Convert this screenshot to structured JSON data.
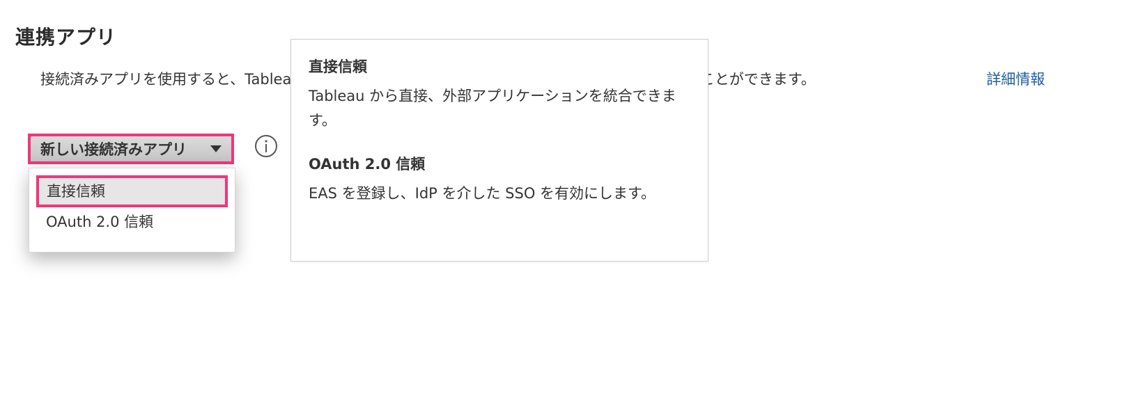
{
  "page": {
    "title": "連携アプリ",
    "intro_text": "接続済みアプリを使用すると、Tableau と外部アプリケーションの間の信頼関係を作成し、管理することができます。",
    "intro_link": "詳細情報"
  },
  "dropdown": {
    "label": "新しい接続済みアプリ",
    "items": [
      {
        "label": "直接信頼",
        "selected": true
      },
      {
        "label": "OAuth 2.0 信頼",
        "selected": false
      }
    ]
  },
  "tooltip": {
    "sections": [
      {
        "title": "直接信頼",
        "body": "Tableau から直接、外部アプリケーションを統合できます。"
      },
      {
        "title": "OAuth 2.0 信頼",
        "body": "EAS を登録し、IdP を介した SSO を有効にします。"
      }
    ]
  },
  "colors": {
    "highlight": "#f2357a",
    "link": "#1f5fa0"
  },
  "icons": {
    "info": "info-icon",
    "caret": "caret-down-icon"
  }
}
